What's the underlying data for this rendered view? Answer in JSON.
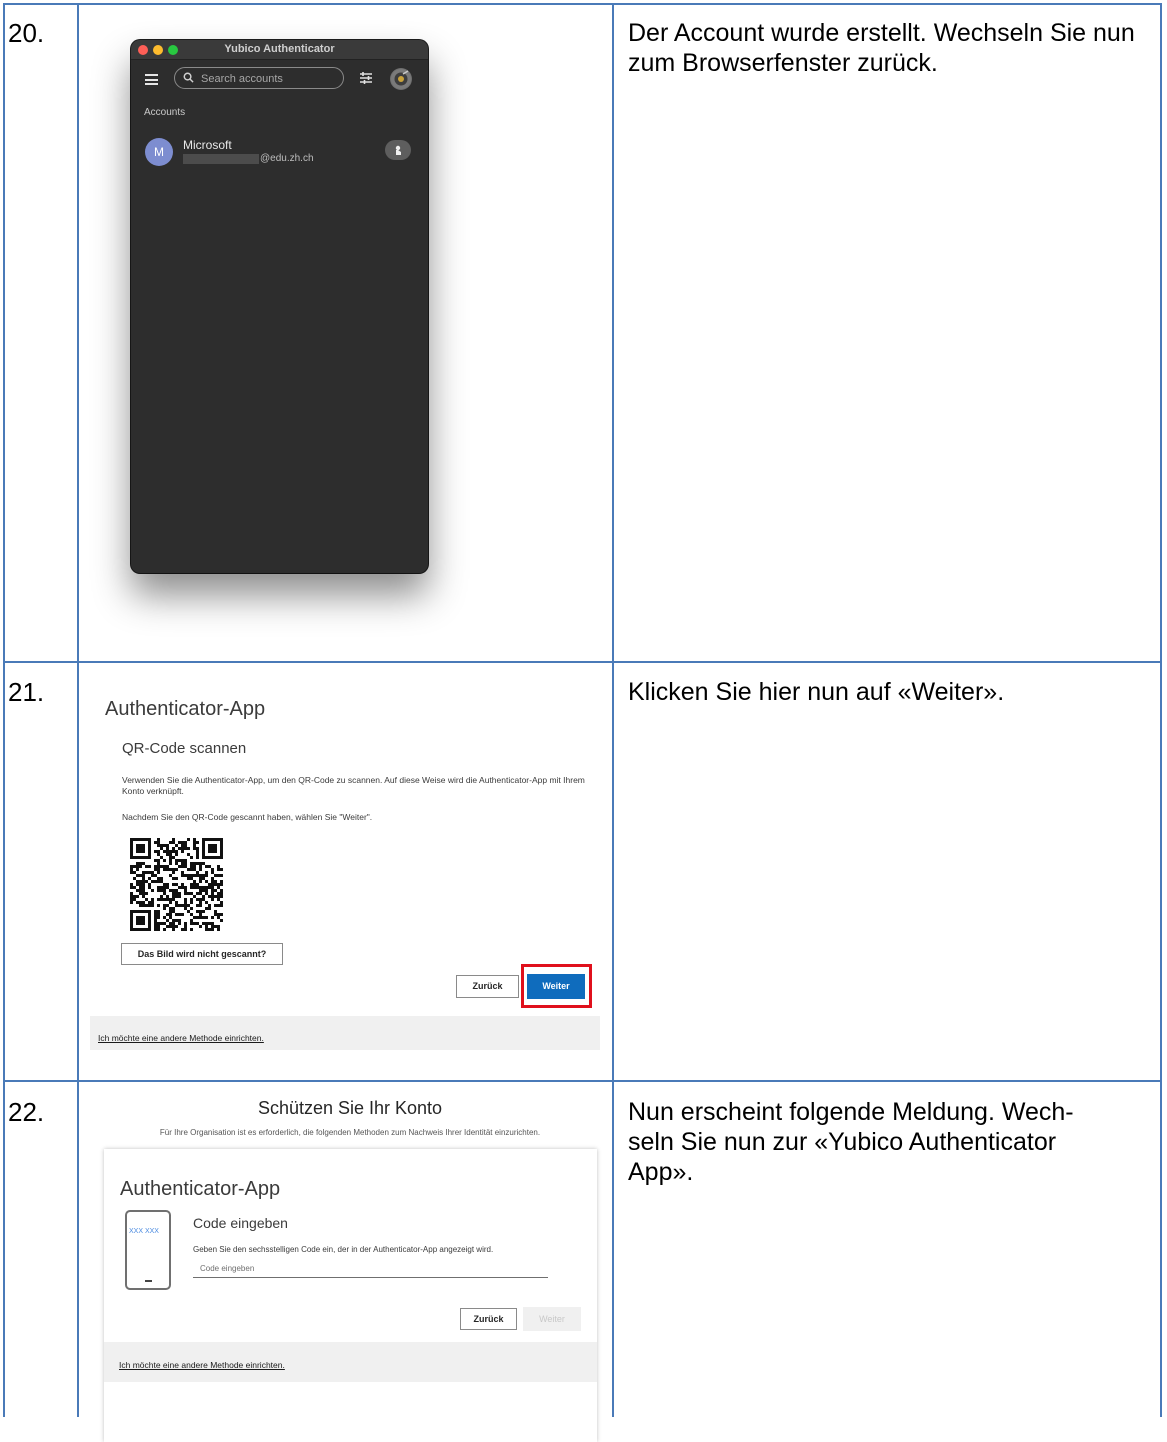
{
  "steps": [
    {
      "number": "20.",
      "instruction": "Der Account wurde erstellt. Wechseln Sie nun zum Browserfenster zurück."
    },
    {
      "number": "21.",
      "instruction": "Klicken Sie hier nun auf «Weiter»."
    },
    {
      "number": "22.",
      "instruction": "Nun erscheint folgende Meldung. Wech-seln Sie nun zur «Yubico Authenticator App»."
    }
  ],
  "yubico": {
    "window_title": "Yubico Authenticator",
    "search_placeholder": "Search accounts",
    "section_label": "Accounts",
    "account": {
      "avatar_letter": "M",
      "name": "Microsoft",
      "email_suffix": "@edu.zh.ch"
    }
  },
  "qr_screen": {
    "title": "Authenticator-App",
    "subtitle": "QR-Code scannen",
    "paragraph1": "Verwenden Sie die Authenticator-App, um den QR-Code zu scannen. Auf diese Weise wird die Authenticator-App mit Ihrem Konto verknüpft.",
    "paragraph2": "Nachdem Sie den QR-Code gescannt haben, wählen Sie \"Weiter\".",
    "cant_scan_button": "Das Bild wird nicht gescannt?",
    "back_button": "Zurück",
    "next_button": "Weiter",
    "other_method_link": "Ich möchte eine andere Methode einrichten."
  },
  "code_screen": {
    "heading": "Schützen Sie Ihr Konto",
    "note": "Für Ihre Organisation ist es erforderlich, die folgenden Methoden zum Nachweis Ihrer Identität einzurichten.",
    "title": "Authenticator-App",
    "phone_code": "XXX XXX",
    "subtitle": "Code eingeben",
    "description": "Geben Sie den sechsstelligen Code ein, der in der Authenticator-App angezeigt wird.",
    "input_placeholder": "Code eingeben",
    "back_button": "Zurück",
    "next_button": "Weiter",
    "other_method_link": "Ich möchte eine andere Methode einrichten."
  },
  "colors": {
    "table_border": "#4a7ab8",
    "ms_primary": "#0f6cbd",
    "highlight": "#e0101c"
  }
}
